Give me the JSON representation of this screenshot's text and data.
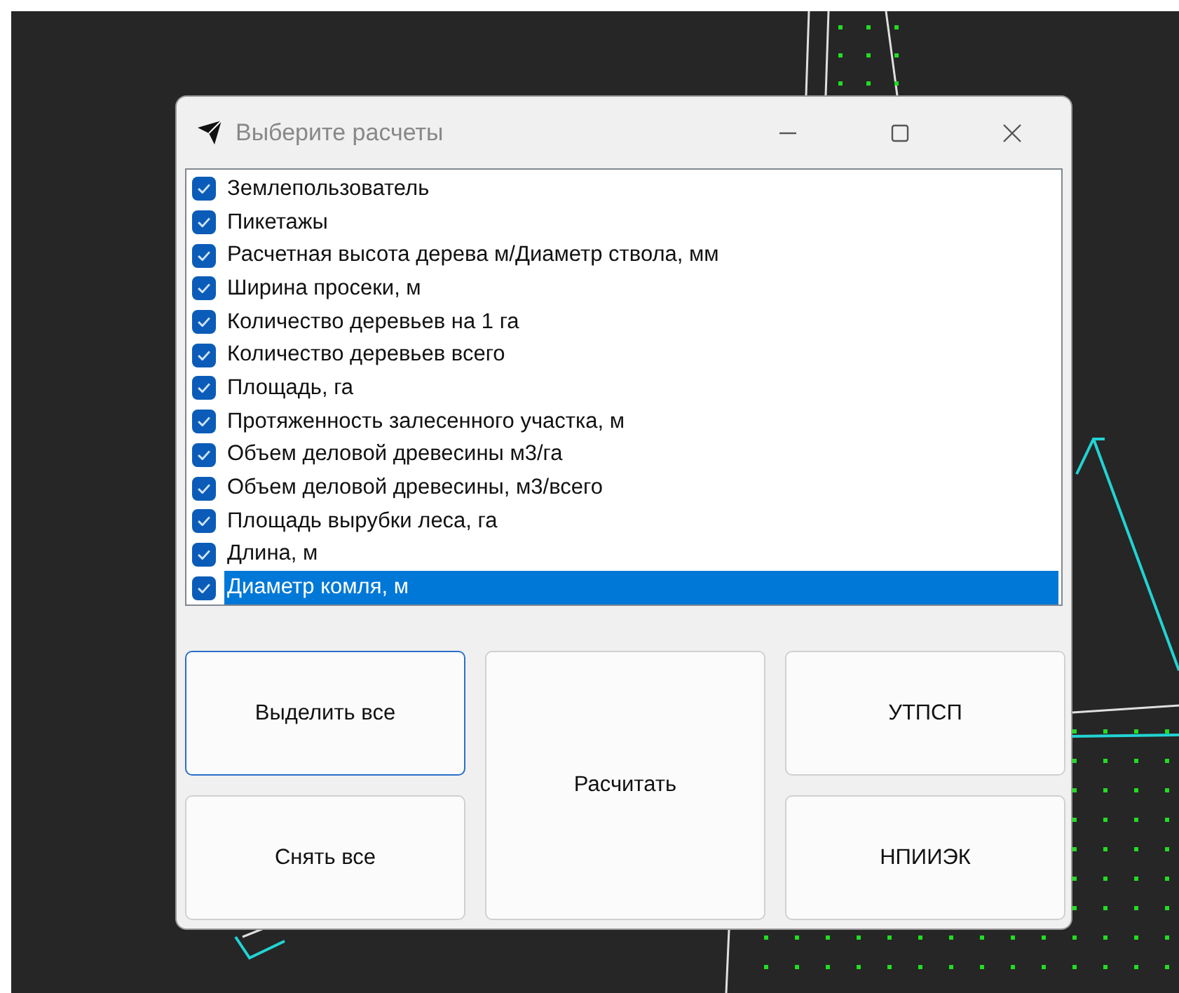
{
  "window": {
    "title": "Выберите расчеты"
  },
  "items": [
    {
      "label": "Землепользователь",
      "checked": true,
      "selected": false
    },
    {
      "label": "Пикетажы",
      "checked": true,
      "selected": false
    },
    {
      "label": "Расчетная высота дерева м/Диаметр ствола, мм",
      "checked": true,
      "selected": false
    },
    {
      "label": "Ширина просеки, м",
      "checked": true,
      "selected": false
    },
    {
      "label": "Количество деревьев на 1 га",
      "checked": true,
      "selected": false
    },
    {
      "label": "Количество деревьев всего",
      "checked": true,
      "selected": false
    },
    {
      "label": "Площадь, га",
      "checked": true,
      "selected": false
    },
    {
      "label": "Протяженность залесенного участка, м",
      "checked": true,
      "selected": false
    },
    {
      "label": "Объем деловой древесины м3/га",
      "checked": true,
      "selected": false
    },
    {
      "label": "Объем деловой древесины, м3/всего",
      "checked": true,
      "selected": false
    },
    {
      "label": "Площадь вырубки леса, га",
      "checked": true,
      "selected": false
    },
    {
      "label": "Длина, м",
      "checked": true,
      "selected": false
    },
    {
      "label": "Диаметр комля, м",
      "checked": true,
      "selected": true
    }
  ],
  "buttons": [
    {
      "label": "Выделить все",
      "focused": true
    },
    {
      "label": "Снять все",
      "focused": false
    },
    {
      "label": "Расчитать",
      "focused": false
    },
    {
      "label": "УТПСП",
      "focused": false
    },
    {
      "label": "НПИИЭК",
      "focused": false
    }
  ]
}
